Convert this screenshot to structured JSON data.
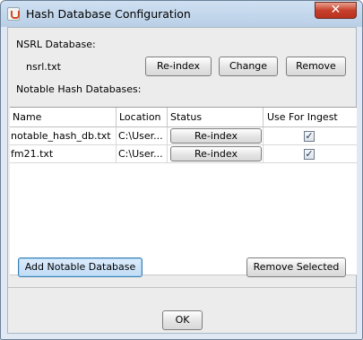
{
  "window": {
    "title": "Hash Database Configuration",
    "close_glyph": "✕"
  },
  "nsrl": {
    "section_label": "NSRL Database:",
    "file_name": "nsrl.txt",
    "reindex_label": "Re-index",
    "change_label": "Change",
    "remove_label": "Remove"
  },
  "notable": {
    "section_label": "Notable Hash Databases:",
    "columns": [
      "Name",
      "Location",
      "Status",
      "Use For Ingest"
    ],
    "rows": [
      {
        "name": "notable_hash_db.txt",
        "location": "C:\\User...",
        "status_button": "Re-index",
        "use_for_ingest": true
      },
      {
        "name": "fm21.txt",
        "location": "C:\\User...",
        "status_button": "Re-index",
        "use_for_ingest": true
      }
    ]
  },
  "actions": {
    "add_label": "Add Notable Database",
    "remove_selected_label": "Remove Selected",
    "ok_label": "OK"
  },
  "icons": {
    "app": "java-coffee-icon",
    "close": "close-icon",
    "check": "✓"
  },
  "colors": {
    "titlebar": "#c6d8ec",
    "close_button": "#c7402b",
    "focus_accent": "#3c7fb1"
  }
}
